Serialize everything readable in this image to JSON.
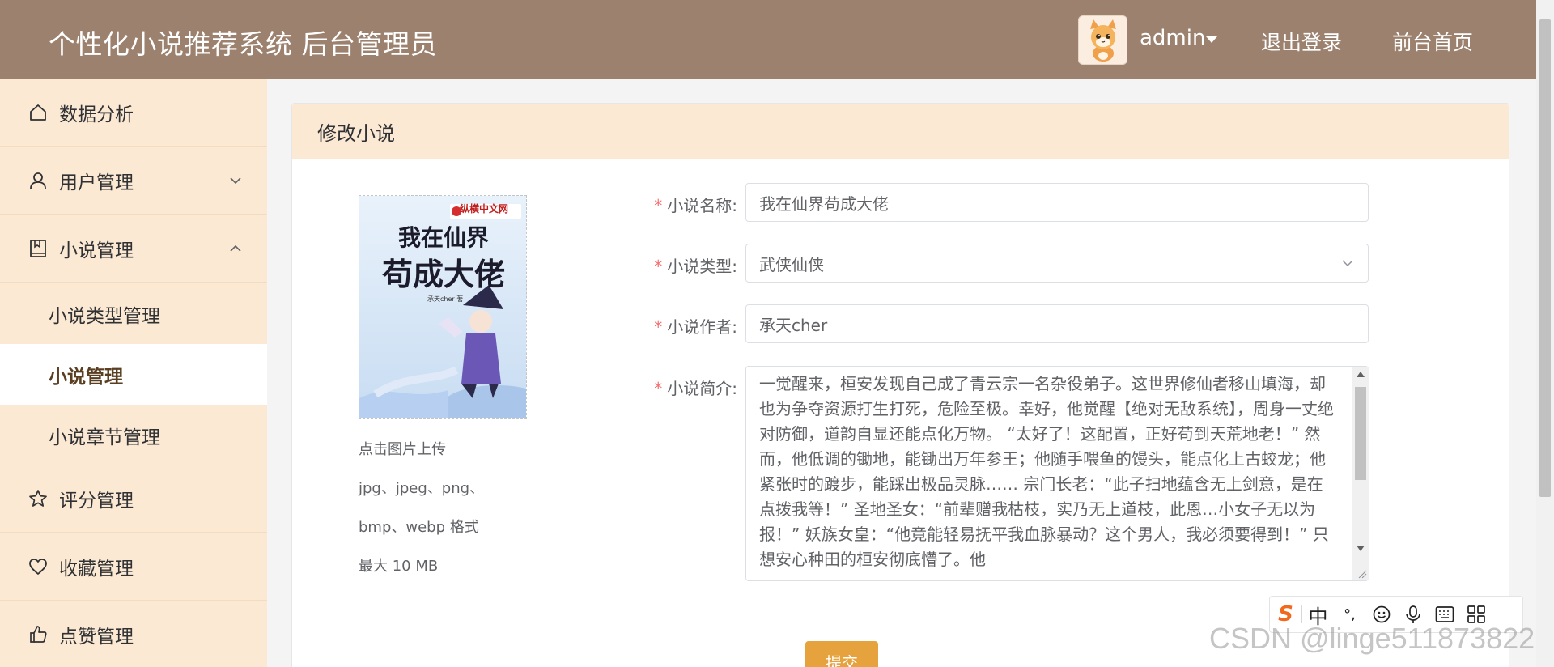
{
  "header": {
    "title": "个性化小说推荐系统 后台管理员",
    "user_name": "admin",
    "logout": "退出登录",
    "home": "前台首页"
  },
  "sidebar": {
    "items": [
      {
        "label": "数据分析",
        "icon": "home-icon"
      },
      {
        "label": "用户管理",
        "icon": "user-icon",
        "arrow": "chevron-down"
      },
      {
        "label": "小说管理",
        "icon": "book-icon",
        "arrow": "chevron-up"
      },
      {
        "label": "评分管理",
        "icon": "star-icon"
      },
      {
        "label": "收藏管理",
        "icon": "heart-icon"
      },
      {
        "label": "点赞管理",
        "icon": "thumb-up-icon"
      }
    ],
    "sub_items": [
      {
        "label": "小说类型管理",
        "active": false
      },
      {
        "label": "小说管理",
        "active": true
      },
      {
        "label": "小说章节管理",
        "active": false
      }
    ]
  },
  "card": {
    "title": "修改小说",
    "cover": {
      "publisher": "纵横中文网",
      "title_line1": "我在仙界",
      "title_line2": "苟成大佬",
      "author_small": "承天cher 著"
    },
    "upload_notes": [
      "点击图片上传",
      "jpg、jpeg、png、",
      "bmp、webp 格式",
      "最大 10 MB"
    ],
    "form": {
      "name_label": "小说名称:",
      "name_value": "我在仙界苟成大佬",
      "type_label": "小说类型:",
      "type_value": "武侠仙侠",
      "author_label": "小说作者:",
      "author_value": "承天cher",
      "intro_label": "小说简介:",
      "intro_value": "一觉醒来，桓安发现自己成了青云宗一名杂役弟子。这世界修仙者移山填海，却也为争夺资源打生打死，危险至极。幸好，他觉醒【绝对无敌系统】，周身一丈绝对防御，道韵自显还能点化万物。 “太好了！这配置，正好苟到天荒地老！” 然而，他低调的锄地，能锄出万年参王；他随手喂鱼的馒头，能点化上古蛟龙；他紧张时的踱步，能踩出极品灵脉…… 宗门长老：“此子扫地蕴含无上剑意，是在点拨我等！” 圣地圣女：“前辈赠我枯枝，实乃无上道枝，此恩…小女子无以为报！” 妖族女皇：“他竟能轻易抚平我血脉暴动？这个男人，我必须要得到！” 只想安心种田的桓安彻底懵了。他",
      "required_mark": "*",
      "submit": "提交"
    }
  },
  "ime": {
    "logo": "S",
    "lang": "中",
    "punct": "°,"
  },
  "watermark": "CSDN @linge511873822",
  "colors": {
    "header_bg": "#9b816e",
    "sidebar_bg": "#fbe9d4",
    "accent": "#e6a23c",
    "required": "#f56c6c"
  }
}
